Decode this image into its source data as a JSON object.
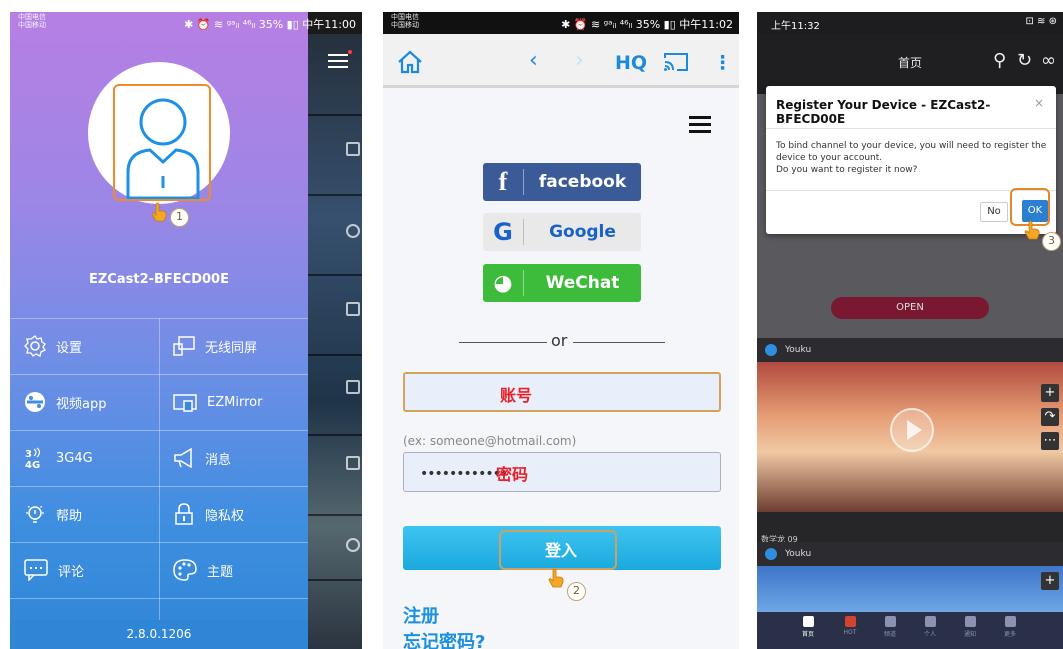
{
  "panel1": {
    "status": {
      "carrier": "中国电信\n中国移动",
      "right": "✱ ⏰ ≋ ᵍᵃᵢₗ ⁴⁶ₗₗ 35% ▮▯ 中午11:00"
    },
    "device_name": "EZCast2-BFECD00E",
    "menu": [
      {
        "label": "设置",
        "icon": "gear-icon"
      },
      {
        "label": "无线同屏",
        "icon": "screen-mirror-icon"
      },
      {
        "label": "视频app",
        "icon": "video-app-icon"
      },
      {
        "label": "EZMirror",
        "icon": "ezmirror-icon"
      },
      {
        "label": "3G4G",
        "icon": "signal-3g4g-icon"
      },
      {
        "label": "消息",
        "icon": "megaphone-icon"
      },
      {
        "label": "帮助",
        "icon": "bulb-icon"
      },
      {
        "label": "隐私权",
        "icon": "lock-icon"
      },
      {
        "label": "评论",
        "icon": "comment-icon"
      },
      {
        "label": "主题",
        "icon": "palette-icon"
      }
    ],
    "version": "2.8.0.1206",
    "step": "1"
  },
  "panel2": {
    "status": {
      "carrier": "中国电信\n中国移动",
      "right": "✱ ⏰ ≋ ᵍᵃᵢₗ ⁴⁶ₗₗ 35% ▮▯ 中午11:02"
    },
    "nav": {
      "back": "‹",
      "forward": "›",
      "quality": "HQ",
      "more": "⋮"
    },
    "social": [
      {
        "label": "facebook",
        "icon_text": "f",
        "bg": "#3b5a98",
        "fg": "#ffffff"
      },
      {
        "label": "Google",
        "icon_text": "G",
        "bg": "#e9e9e9",
        "fg": "#1a62c7"
      },
      {
        "label": "WeChat",
        "icon_text": "◕",
        "bg": "#3dbb3a",
        "fg": "#ffffff"
      }
    ],
    "or_text": "or",
    "account_label": "账号",
    "email_hint": "(ex: someone@hotmail.com)",
    "password_mask": "••••••••••••",
    "password_label": "密码",
    "login_label": "登入",
    "register_link": "注册",
    "forgot_link": "忘记密码?",
    "step": "2"
  },
  "panel3": {
    "status": {
      "time": "上午11:32",
      "right": "⊡ ≋ ⊛"
    },
    "title": "首页",
    "dialog": {
      "title": "Register Your Device - EZCast2-BFECD00E",
      "close": "×",
      "body": "To bind channel to your device, you will need to register the device to your account.\nDo you want to register it now?",
      "no_label": "No",
      "ok_label": "OK"
    },
    "open_label": "OPEN",
    "source1": "Youku",
    "episode": "数学龙 09",
    "source2": "Youku",
    "tabs": [
      "首页",
      "HOT",
      "频道",
      "个人",
      "通知",
      "更多"
    ],
    "step": "3"
  }
}
